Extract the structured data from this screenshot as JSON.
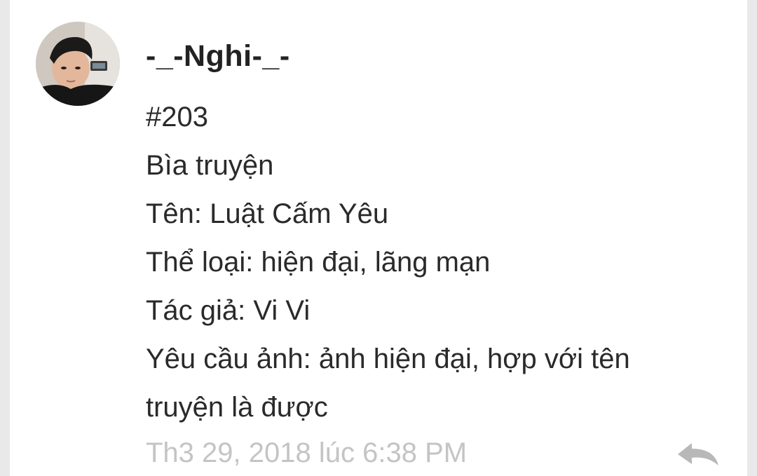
{
  "comment": {
    "username": "-_-Nghi-_-",
    "lines": [
      "#203",
      "Bìa truyện",
      "Tên: Luật Cấm Yêu",
      "Thể loại: hiện đại, lãng mạn",
      "Tác giả: Vi Vi",
      "Yêu cầu ảnh: ảnh hiện đại, hợp với tên",
      "truyện là được"
    ],
    "timestamp": "Th3 29, 2018 lúc 6:38 PM",
    "avatar_icon": "user-avatar-photo",
    "reply_icon": "reply-arrow-icon"
  },
  "colors": {
    "background": "#e9e9e9",
    "card": "#ffffff",
    "text": "#2a2a2a",
    "timestamp": "#c4c4c4",
    "reply_icon": "#b8b8b8"
  }
}
